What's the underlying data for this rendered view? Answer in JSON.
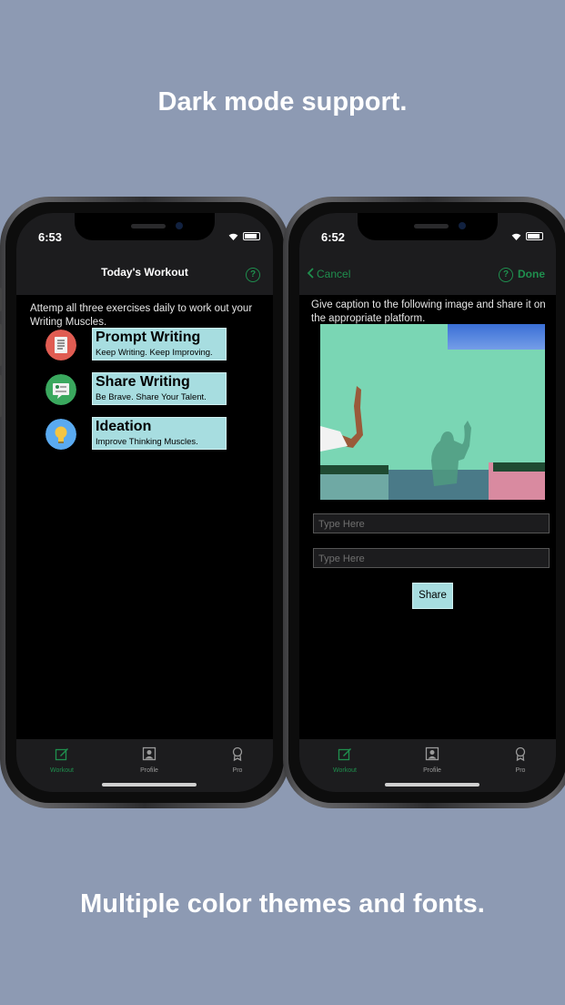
{
  "headlines": {
    "top": "Dark mode support.",
    "bottom": "Multiple color themes and fonts."
  },
  "colors": {
    "background": "#8d9ab3",
    "accent": "#1f8f4e",
    "card": "#a7dde0"
  },
  "left_phone": {
    "status": {
      "time": "6:53"
    },
    "nav": {
      "title": "Today's Workout",
      "help_icon": "?"
    },
    "intro": "Attemp all three exercises daily to work out your Writing Muscles.",
    "exercises": [
      {
        "title": "Prompt Writing",
        "subtitle": "Keep Writing. Keep Improving.",
        "icon": "document-icon"
      },
      {
        "title": "Share Writing",
        "subtitle": "Be Brave. Share Your Talent.",
        "icon": "share-writing-icon"
      },
      {
        "title": "Ideation",
        "subtitle": "Improve Thinking Muscles.",
        "icon": "lightbulb-icon"
      }
    ],
    "tabs": [
      {
        "label": "Workout"
      },
      {
        "label": "Profile"
      },
      {
        "label": "Pro"
      }
    ]
  },
  "right_phone": {
    "status": {
      "time": "6:52"
    },
    "nav": {
      "cancel": "Cancel",
      "help_icon": "?",
      "done": "Done"
    },
    "prompt": "Give caption to the following image and share it on the appropriate platform.",
    "fields": [
      {
        "placeholder": "Type Here"
      },
      {
        "placeholder": "Type Here"
      }
    ],
    "share_label": "Share",
    "tabs": [
      {
        "label": "Workout"
      },
      {
        "label": "Profile"
      },
      {
        "label": "Pro"
      }
    ]
  }
}
